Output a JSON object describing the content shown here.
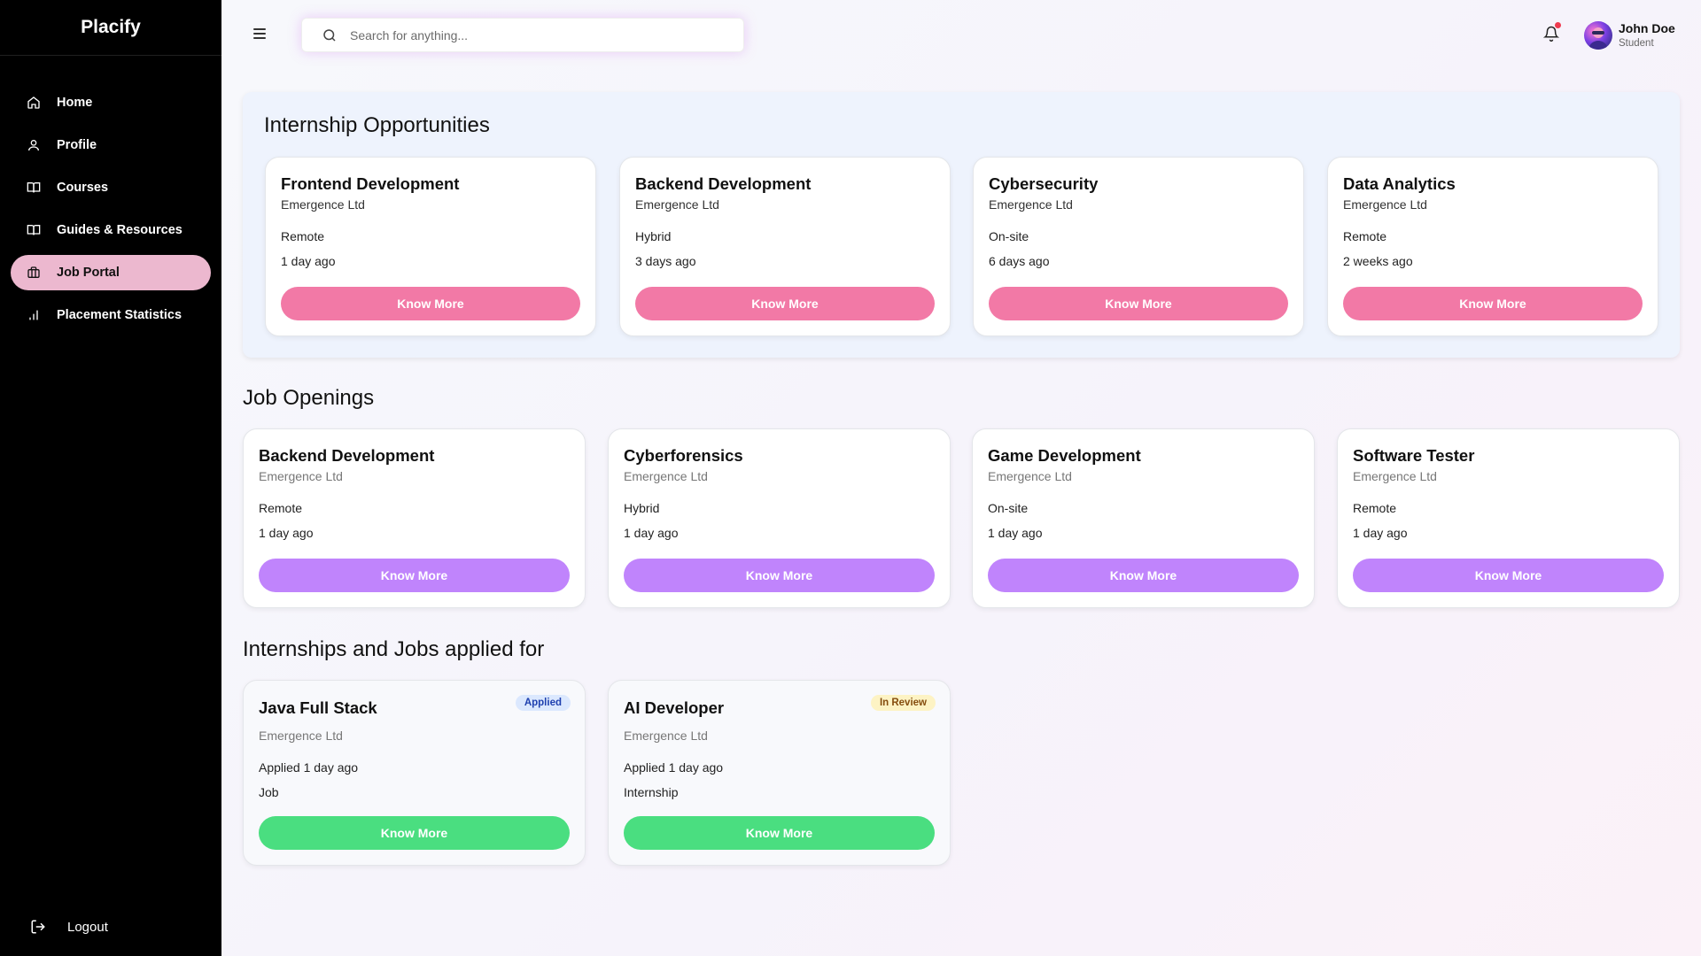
{
  "app": {
    "brand": "Placify"
  },
  "sidebar": {
    "items": [
      {
        "label": "Home",
        "icon": "home-icon",
        "active": false
      },
      {
        "label": "Profile",
        "icon": "user-icon",
        "active": false
      },
      {
        "label": "Courses",
        "icon": "book-icon",
        "active": false
      },
      {
        "label": "Guides & Resources",
        "icon": "book-open-icon",
        "active": false
      },
      {
        "label": "Job Portal",
        "icon": "briefcase-icon",
        "active": true
      },
      {
        "label": "Placement Statistics",
        "icon": "bar-chart-icon",
        "active": false
      }
    ],
    "logout_label": "Logout"
  },
  "header": {
    "search_placeholder": "Search for anything...",
    "user_name": "John Doe",
    "user_role": "Student"
  },
  "colors": {
    "accent_pink": "#f279a6",
    "accent_purple": "#c084fc",
    "accent_green": "#4ade80",
    "active_nav": "#ecb8cf"
  },
  "internships": {
    "title": "Internship Opportunities",
    "cards": [
      {
        "title": "Frontend Development",
        "company": "Emergence Ltd",
        "mode": "Remote",
        "posted": "1 day ago",
        "button": "Know More"
      },
      {
        "title": "Backend Development",
        "company": "Emergence Ltd",
        "mode": "Hybrid",
        "posted": "3 days ago",
        "button": "Know More"
      },
      {
        "title": "Cybersecurity",
        "company": "Emergence Ltd",
        "mode": "On-site",
        "posted": "6 days ago",
        "button": "Know More"
      },
      {
        "title": "Data Analytics",
        "company": "Emergence Ltd",
        "mode": "Remote",
        "posted": "2 weeks ago",
        "button": "Know More"
      }
    ]
  },
  "jobs": {
    "title": "Job Openings",
    "cards": [
      {
        "title": "Backend Development",
        "company": "Emergence Ltd",
        "mode": "Remote",
        "posted": "1 day ago",
        "button": "Know More"
      },
      {
        "title": "Cyberforensics",
        "company": "Emergence Ltd",
        "mode": "Hybrid",
        "posted": "1 day ago",
        "button": "Know More"
      },
      {
        "title": "Game Development",
        "company": "Emergence Ltd",
        "mode": "On-site",
        "posted": "1 day ago",
        "button": "Know More"
      },
      {
        "title": "Software Tester",
        "company": "Emergence Ltd",
        "mode": "Remote",
        "posted": "1 day ago",
        "button": "Know More"
      }
    ]
  },
  "applied": {
    "title": "Internships and Jobs applied for",
    "cards": [
      {
        "title": "Java Full Stack",
        "company": "Emergence Ltd",
        "status": "Applied",
        "applied": "Applied 1 day ago",
        "type": "Job",
        "button": "Know More"
      },
      {
        "title": "AI Developer",
        "company": "Emergence Ltd",
        "status": "In Review",
        "applied": "Applied 1 day ago",
        "type": "Internship",
        "button": "Know More"
      }
    ]
  }
}
